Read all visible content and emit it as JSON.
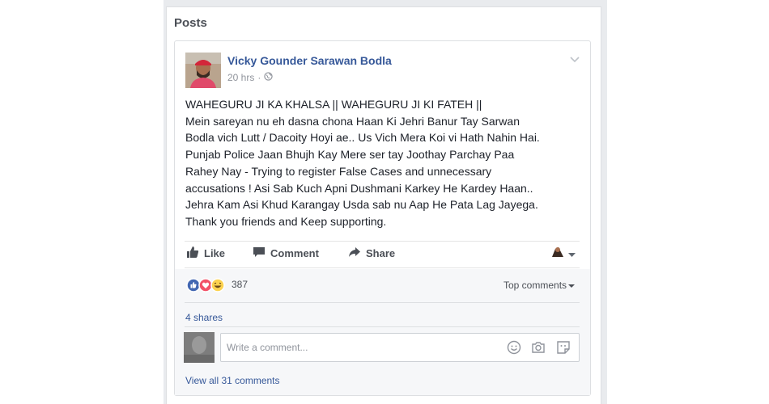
{
  "section": {
    "title": "Posts"
  },
  "post": {
    "author": "Vicky Gounder Sarawan Bodla",
    "time": "20 hrs",
    "separator": "·",
    "privacy_icon": "globe-icon",
    "text_lines": [
      "WAHEGURU JI KA KHALSA || WAHEGURU JI KI FATEH ||",
      "Mein sareyan nu eh dasna chona Haan Ki Jehri Banur Tay Sarwan",
      "Bodla vich Lutt / Dacoity Hoyi ae.. Us Vich Mera Koi vi Hath Nahin Hai.",
      "Punjab Police Jaan Bhujh Kay Mere ser tay Joothay Parchay Paa",
      "Rahey Nay - Trying to register False Cases and unnecessary",
      "accusations ! Asi Sab Kuch Apni Dushmani Karkey He Kardey Haan..",
      "Jehra Kam Asi Khud Karangay Usda sab nu Aap He Pata Lag Jayega.",
      "Thank you friends and Keep supporting."
    ]
  },
  "actions": {
    "like": "Like",
    "comment": "Comment",
    "share": "Share"
  },
  "reactions": {
    "count": "387",
    "icons": [
      "like-icon",
      "love-icon",
      "haha-icon"
    ],
    "top_comments": "Top comments"
  },
  "shares": "4 shares",
  "comment_input": {
    "placeholder": "Write a comment..."
  },
  "view_all": "View all 31 comments",
  "colors": {
    "link": "#365899",
    "like_blue": "#4267b2",
    "love_red": "#f25268",
    "haha_yellow": "#fcd24f",
    "border": "#dddfe2",
    "panel_bg": "#f6f7f9"
  }
}
